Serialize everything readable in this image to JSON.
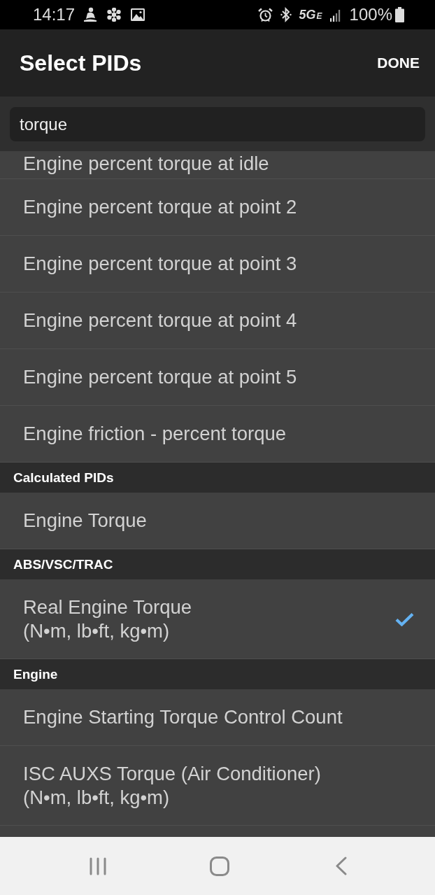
{
  "status_bar": {
    "time": "14:17",
    "network": "5G",
    "network_sub": "E",
    "battery": "100%"
  },
  "app_bar": {
    "title": "Select PIDs",
    "action": "DONE"
  },
  "search": {
    "value": "torque"
  },
  "sections": [
    {
      "items": [
        {
          "label": "Engine percent torque at idle",
          "checked": false
        },
        {
          "label": "Engine percent torque at point 2",
          "checked": false
        },
        {
          "label": "Engine percent torque at point 3",
          "checked": false
        },
        {
          "label": "Engine percent torque at point 4",
          "checked": false
        },
        {
          "label": "Engine percent torque at point 5",
          "checked": false
        },
        {
          "label": "Engine friction - percent torque",
          "checked": false
        }
      ]
    },
    {
      "header": "Calculated PIDs",
      "items": [
        {
          "label": "Engine Torque",
          "checked": false
        }
      ]
    },
    {
      "header": "ABS/VSC/TRAC",
      "items": [
        {
          "label": "Real Engine Torque",
          "units": "(N•m, lb•ft, kg•m)",
          "checked": true
        }
      ]
    },
    {
      "header": "Engine",
      "items": [
        {
          "label": "Engine Starting Torque Control Count",
          "checked": false
        },
        {
          "label": "ISC AUXS Torque (Air Conditioner)",
          "units": "(N•m, lb•ft, kg•m)",
          "checked": false
        }
      ]
    }
  ]
}
